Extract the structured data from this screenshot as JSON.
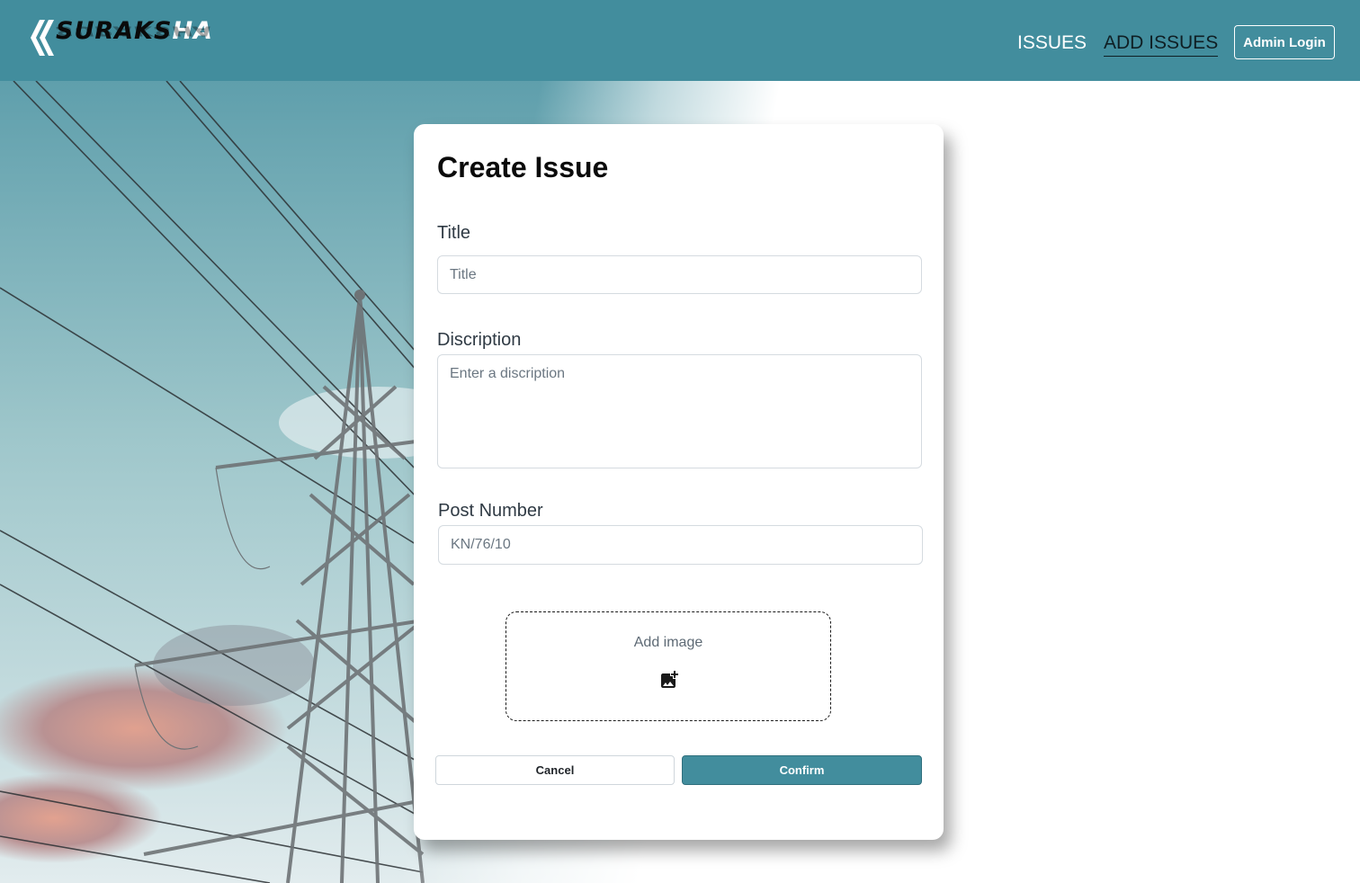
{
  "brand": {
    "logo_main": "SURAKS",
    "logo_highlight": "HA"
  },
  "nav": {
    "issues": "ISSUES",
    "add_issues": "ADD ISSUES",
    "admin_login": "Admin Login"
  },
  "form": {
    "heading": "Create Issue",
    "title_label": "Title",
    "title_placeholder": "Title",
    "description_label": "Discription",
    "description_placeholder": "Enter a discription",
    "post_label": "Post Number",
    "post_placeholder": "KN/76/10",
    "image_label": "Add image",
    "image_icon": "add-photo-icon",
    "cancel_label": "Cancel",
    "confirm_label": "Confirm"
  },
  "colors": {
    "accent": "#428d9d",
    "text": "#2f3a44"
  }
}
